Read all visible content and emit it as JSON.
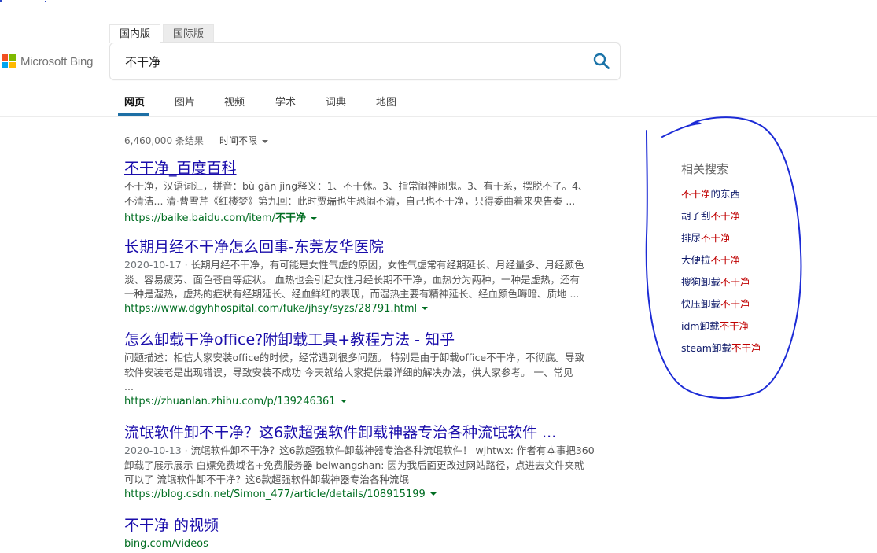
{
  "logo": {
    "text": "Microsoft Bing",
    "colors": [
      "#f25022",
      "#7fba00",
      "#00a4ef",
      "#ffb900"
    ]
  },
  "market_tabs": [
    {
      "label": "国内版",
      "active": true
    },
    {
      "label": "国际版",
      "active": false
    }
  ],
  "search": {
    "query": "不干净",
    "icon": "search-icon"
  },
  "nav": {
    "items": [
      "网页",
      "图片",
      "视频",
      "学术",
      "词典",
      "地图"
    ],
    "active_index": 0,
    "accent": "#1d6fa5"
  },
  "meta": {
    "count": "6,460,000 条结果",
    "time_filter": "时间不限"
  },
  "results": [
    {
      "title": "不干净_百度百科",
      "snippet": [
        "不干净，汉语词汇，拼音：bù gān jìng释义：1、不干休。3、指常闹神闹鬼。3、有干系，摆脱不了。4、",
        "不清洁... 清·曹雪芹《红楼梦》第九回：此时贾瑞也生恐闹不清，自己也不干净，只得委曲着来央告秦 ..."
      ],
      "url_prefix": "https://baike.baidu.com/item/",
      "url_bold": "不干净"
    },
    {
      "title": "长期月经不干净怎么回事-东莞友华医院",
      "date": "2020-10-17 · ",
      "snippet": [
        "长期月经不干净，有可能是女性气虚的原因，女性气虚常有经期延长、月经量多、月经颜色",
        "淡、容易疲劳、面色苍白等症状。 血热也会引起女性月经长期不干净，血热分为两种，一种是虚热，还有",
        "一种是湿热，虚热的症状有经期延长、经血鲜红的表现，而湿热主要有精神延长、经血颜色晦暗、质地 ..."
      ],
      "url_prefix": "https://www.dgyhhospital.com/fuke/jhsy/syzs/28791.html",
      "url_bold": ""
    },
    {
      "title": "怎么卸载干净office?附卸载工具+教程方法 - 知乎",
      "snippet": [
        "问题描述：相信大家安装office的时候，经常遇到很多问题。 特别是由于卸载office不干净，不彻底。导致",
        "软件安装老是出现错误，导致安装不成功 今天就给大家提供最详细的解决办法，供大家参考。 一、常见",
        "..."
      ],
      "url_prefix": "https://zhuanlan.zhihu.com/p/139246361",
      "url_bold": ""
    },
    {
      "title": "流氓软件卸不干净？这6款超强软件卸载神器专治各种流氓软件 ...",
      "date": "2020-10-13 · ",
      "snippet": [
        "流氓软件卸不干净？这6款超强软件卸载神器专治各种流氓软件！ wjhtwx: 作者有本事把360",
        "卸载了展示展示 白嫖免费域名+免费服务器 beiwangshan: 因为我后面更改过网站路径，点进去文件夹就",
        "可以了 流氓软件卸不干净？这6款超强软件卸载神器专治各种流氓"
      ],
      "url_prefix": "https://blog.csdn.net/Simon_477/article/details/108915199",
      "url_bold": ""
    },
    {
      "title": "不干净 的视频",
      "snippet": [],
      "url_prefix": "bing.com/videos",
      "url_bold": ""
    }
  ],
  "related": {
    "title": "相关搜索",
    "highlight_color": "#c00000",
    "items": [
      {
        "pre": "",
        "hl": "不干净",
        "post": "的东西"
      },
      {
        "pre": "胡子刮",
        "hl": "不干净",
        "post": ""
      },
      {
        "pre": "排尿",
        "hl": "不干净",
        "post": ""
      },
      {
        "pre": "大便拉",
        "hl": "不干净",
        "post": ""
      },
      {
        "pre": "搜狗卸载",
        "hl": "不干净",
        "post": ""
      },
      {
        "pre": "快压卸载",
        "hl": "不干净",
        "post": ""
      },
      {
        "pre": "idm卸载",
        "hl": "不干净",
        "post": ""
      },
      {
        "pre": "steam卸载",
        "hl": "不干净",
        "post": ""
      }
    ]
  },
  "annotation": {
    "color": "#1c2bd6"
  }
}
